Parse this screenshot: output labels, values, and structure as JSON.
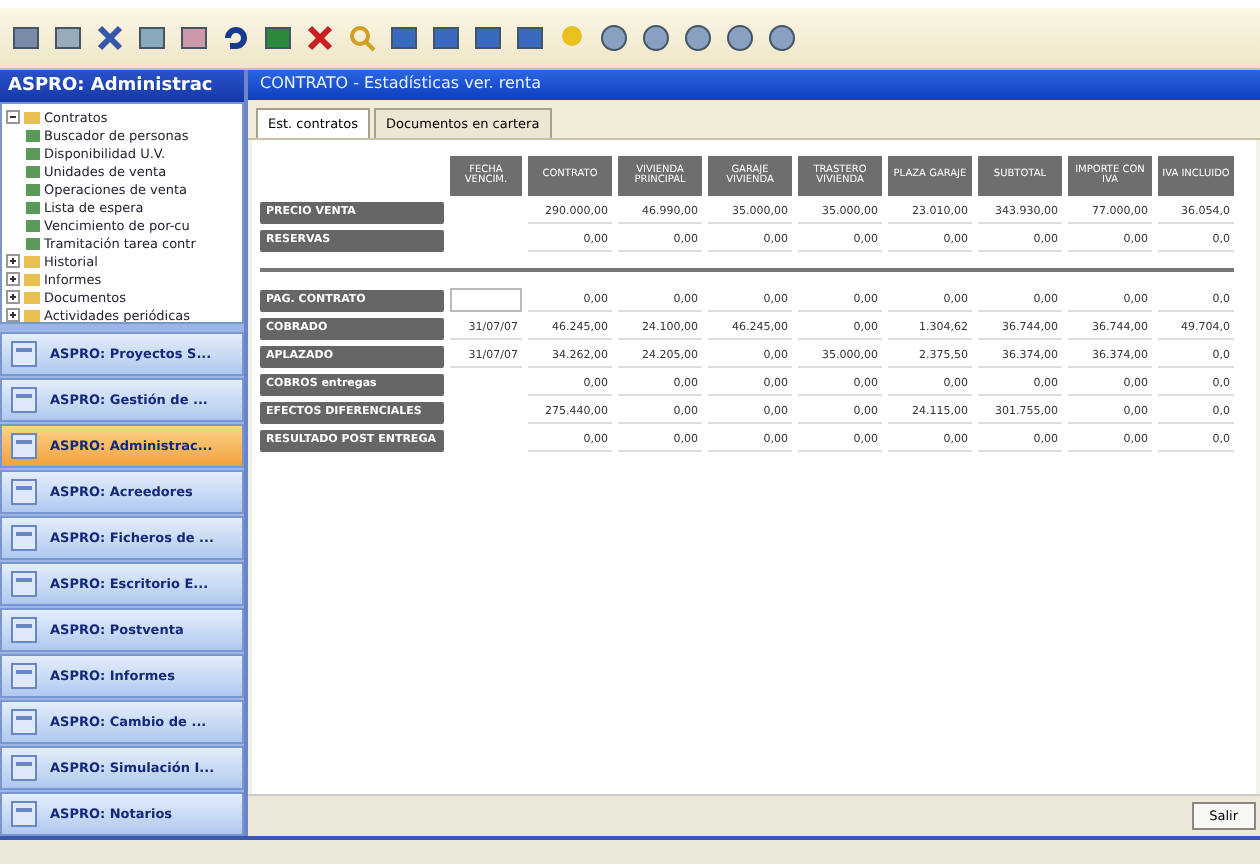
{
  "sidebar": {
    "title": "ASPRO: Administrac",
    "tree": [
      {
        "label": "Contratos",
        "expanded": true,
        "children": [
          {
            "label": "Buscador de personas"
          },
          {
            "label": "Disponibilidad U.V."
          },
          {
            "label": "Unidades de venta"
          },
          {
            "label": "Operaciones de venta"
          },
          {
            "label": "Lista de espera"
          },
          {
            "label": "Vencimiento de por-cu"
          },
          {
            "label": "Tramitación tarea contr"
          }
        ]
      },
      {
        "label": "Historial",
        "expanded": false
      },
      {
        "label": "Informes",
        "expanded": false
      },
      {
        "label": "Documentos",
        "expanded": false
      },
      {
        "label": "Actividades periódicas",
        "expanded": false
      }
    ],
    "modules": [
      {
        "label": "ASPRO: Proyectos S...",
        "selected": false
      },
      {
        "label": "ASPRO: Gestión de ...",
        "selected": false
      },
      {
        "label": "ASPRO: Administrac...",
        "selected": true
      },
      {
        "label": "ASPRO: Acreedores",
        "selected": false
      },
      {
        "label": "ASPRO: Ficheros de ...",
        "selected": false
      },
      {
        "label": "ASPRO: Escritorio E...",
        "selected": false
      },
      {
        "label": "ASPRO: Postventa",
        "selected": false
      },
      {
        "label": "ASPRO: Informes",
        "selected": false
      },
      {
        "label": "ASPRO: Cambio de ...",
        "selected": false
      },
      {
        "label": "ASPRO: Simulación I...",
        "selected": false
      },
      {
        "label": "ASPRO: Notarios",
        "selected": false
      }
    ]
  },
  "document": {
    "title": "CONTRATO - Estadísticas ver. renta",
    "tabs": [
      {
        "label": "Est. contratos",
        "selected": true
      },
      {
        "label": "Documentos en cartera",
        "selected": false
      }
    ],
    "columns": [
      "FECHA VENCIM.",
      "CONTRATO",
      "VIVIENDA PRINCIPAL",
      "GARAJE VIVIENDA",
      "TRASTERO VIVIENDA",
      "PLAZA GARAJE",
      "SUBTOTAL",
      "IMPORTE CON IVA",
      "IVA INCLUIDO"
    ],
    "top_rows": [
      {
        "label": "PRECIO VENTA",
        "cells": [
          "",
          "290.000,00",
          "46.990,00",
          "35.000,00",
          "35.000,00",
          "23.010,00",
          "343.930,00",
          "77.000,00",
          "36.054,0"
        ]
      },
      {
        "label": "RESERVAS",
        "cells": [
          "",
          "0,00",
          "0,00",
          "0,00",
          "0,00",
          "0,00",
          "0,00",
          "0,00",
          "0,0"
        ]
      }
    ],
    "rows": [
      {
        "label": "PAG. CONTRATO",
        "cells": [
          "",
          "0,00",
          "0,00",
          "0,00",
          "0,00",
          "0,00",
          "0,00",
          "0,00",
          "0,0"
        ]
      },
      {
        "label": "COBRADO",
        "cells": [
          "31/07/07",
          "46.245,00",
          "24.100,00",
          "46.245,00",
          "0,00",
          "1.304,62",
          "36.744,00",
          "36.744,00",
          "49.704,0"
        ]
      },
      {
        "label": "APLAZADO",
        "cells": [
          "31/07/07",
          "34.262,00",
          "24.205,00",
          "0,00",
          "35.000,00",
          "2.375,50",
          "36.374,00",
          "36.374,00",
          "0,0"
        ]
      },
      {
        "label": "COBROS entregas",
        "cells": [
          "",
          "0,00",
          "0,00",
          "0,00",
          "0,00",
          "0,00",
          "0,00",
          "0,00",
          "0,0"
        ]
      },
      {
        "label": "EFECTOS DIFERENCIALES",
        "cells": [
          "",
          "275.440,00",
          "0,00",
          "0,00",
          "0,00",
          "24.115,00",
          "301.755,00",
          "0,00",
          "0,0"
        ]
      },
      {
        "label": "RESULTADO POST ENTREGA",
        "cells": [
          "",
          "0,00",
          "0,00",
          "0,00",
          "0,00",
          "0,00",
          "0,00",
          "0,00",
          "0,0"
        ]
      }
    ],
    "button": "Salir"
  }
}
